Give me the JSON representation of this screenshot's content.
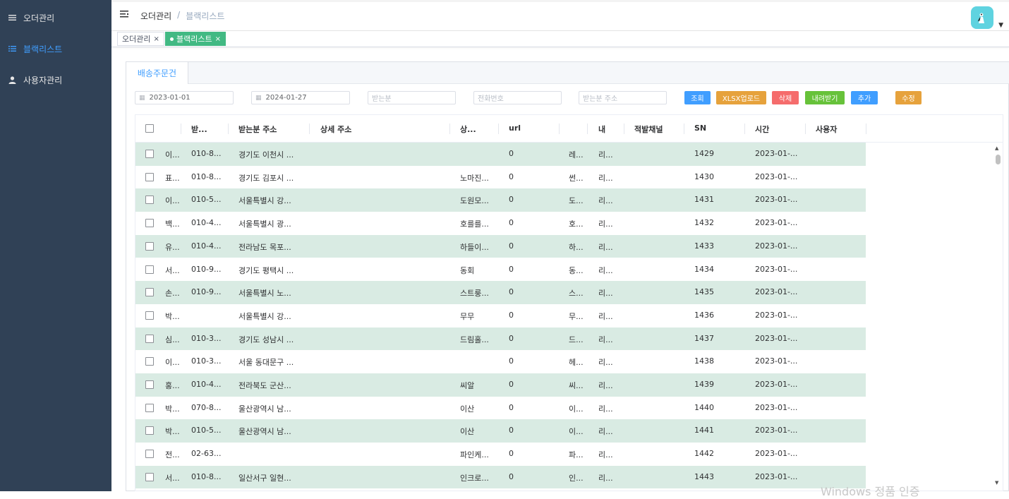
{
  "sidebar": {
    "items": [
      {
        "label": "오더관리",
        "icon": "list-icon"
      },
      {
        "label": "블랙리스트",
        "icon": "list-icon"
      },
      {
        "label": "사용자관리",
        "icon": "user-icon"
      }
    ]
  },
  "header": {
    "breadcrumb": [
      "오더관리",
      "/",
      "블랙리스트"
    ]
  },
  "tags": [
    {
      "label": "오더관리",
      "close": "×"
    },
    {
      "label": "블랙리스트",
      "close": "×"
    }
  ],
  "tab": {
    "label": "배송주문건"
  },
  "filters": {
    "start_date": "2023-01-01",
    "end_date": "2024-01-27",
    "receiver_ph": "받는분",
    "phone_ph": "전화번호",
    "address_ph": "받는분 주소"
  },
  "buttons": {
    "search": "조회",
    "xlsx_upload": "XLSX업로드",
    "delete": "삭제",
    "download": "내려받기",
    "add": "추가",
    "edit": "수정"
  },
  "colors": {
    "sidebar": "#304156",
    "primary": "#409EFF",
    "warning": "#E6A23C",
    "danger": "#F56C6C",
    "success": "#67C23A",
    "row_stripe": "#d9ebe3"
  },
  "table": {
    "headers": [
      "받...",
      "받는분 주소",
      "상세 주소",
      "상...",
      "url",
      "내",
      "적발채널",
      "SN",
      "시간",
      "사용자"
    ],
    "rows": [
      [
        "이...",
        "010-8...",
        "경기도 이천시 ...",
        "",
        "0",
        "레...",
        "리...",
        "1429",
        "2023-01-..."
      ],
      [
        "표...",
        "010-8...",
        "경기도 김포시 ...",
        "노마진...",
        "0",
        "썬...",
        "리...",
        "1430",
        "2023-01-..."
      ],
      [
        "이...",
        "010-5...",
        "서울특별시 강...",
        "도원모...",
        "0",
        "도...",
        "리...",
        "1431",
        "2023-01-..."
      ],
      [
        "백...",
        "010-4...",
        "서울특별시 광...",
        "호를를...",
        "0",
        "호...",
        "리...",
        "1432",
        "2023-01-..."
      ],
      [
        "유...",
        "010-4...",
        "전라남도 목포...",
        "하들이...",
        "0",
        "하...",
        "리...",
        "1433",
        "2023-01-..."
      ],
      [
        "서...",
        "010-9...",
        "경기도 평택시 ...",
        "동회",
        "0",
        "동...",
        "리...",
        "1434",
        "2023-01-..."
      ],
      [
        "손...",
        "010-9...",
        "서울특별시 노...",
        "스트룽...",
        "0",
        "스...",
        "리...",
        "1435",
        "2023-01-..."
      ],
      [
        "박...",
        "",
        "서울특별시 강...",
        "무무",
        "0",
        "무...",
        "리...",
        "1436",
        "2023-01-..."
      ],
      [
        "심...",
        "010-3...",
        "경기도 성남시 ...",
        "드림홀...",
        "0",
        "드...",
        "리...",
        "1437",
        "2023-01-..."
      ],
      [
        "이...",
        "010-3...",
        "서울 동대문구 ...",
        "",
        "0",
        "헤...",
        "리...",
        "1438",
        "2023-01-..."
      ],
      [
        "홍...",
        "010-4...",
        "전라북도 군산...",
        "씨알",
        "0",
        "씨...",
        "리...",
        "1439",
        "2023-01-..."
      ],
      [
        "박...",
        "070-8...",
        "울산광역시 남...",
        "이산",
        "0",
        "이...",
        "리...",
        "1440",
        "2023-01-..."
      ],
      [
        "박...",
        "010-5...",
        "울산광역시 남...",
        "이산",
        "0",
        "이...",
        "리...",
        "1441",
        "2023-01-..."
      ],
      [
        "전...",
        "02-63...",
        "",
        "파인케...",
        "0",
        "파...",
        "리...",
        "1442",
        "2023-01-..."
      ],
      [
        "서...",
        "010-8...",
        "일산서구 일현...",
        "인크로...",
        "0",
        "인...",
        "리...",
        "1443",
        "2023-01-..."
      ]
    ]
  },
  "watermark": "Windows 정품 인증"
}
